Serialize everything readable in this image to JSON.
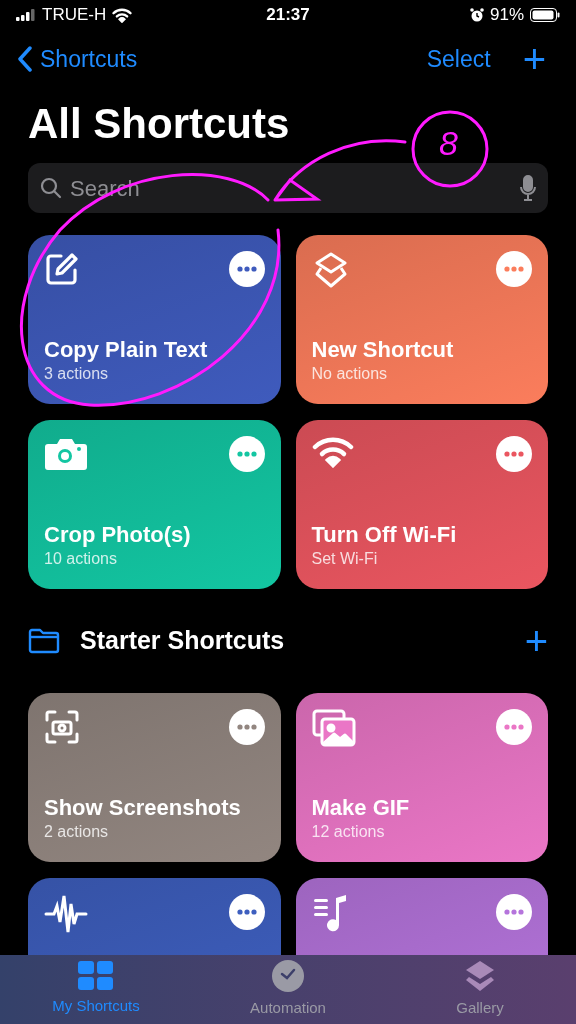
{
  "status_bar": {
    "carrier": "TRUE-H",
    "time": "21:37",
    "battery": "91%"
  },
  "nav": {
    "back": "Shortcuts",
    "select": "Select",
    "add": "+"
  },
  "title": "All Shortcuts",
  "search": {
    "placeholder": "Search"
  },
  "shortcuts": [
    {
      "title": "Copy Plain Text",
      "subtitle": "3 actions",
      "color": "#3f5bbd"
    },
    {
      "title": "New Shortcut",
      "subtitle": "No actions",
      "color": "#fb7d5c"
    },
    {
      "title": "Crop Photo(s)",
      "subtitle": "10 actions",
      "color": "#13c6a2"
    },
    {
      "title": "Turn Off Wi-Fi",
      "subtitle": "Set Wi-Fi",
      "color": "#ea5660"
    }
  ],
  "section": {
    "title": "Starter Shortcuts",
    "add": "+"
  },
  "starter": [
    {
      "title": "Show Screenshots",
      "subtitle": "2 actions",
      "color": "#928680"
    },
    {
      "title": "Make GIF",
      "subtitle": "12 actions",
      "color": "#ea76c6"
    },
    {
      "color": "#3e5fbf"
    },
    {
      "color": "#b574dc"
    }
  ],
  "tabs": [
    {
      "label": "My Shortcuts",
      "selected": true
    },
    {
      "label": "Automation",
      "selected": false
    },
    {
      "label": "Gallery",
      "selected": false
    }
  ],
  "annotation": {
    "label": "8"
  }
}
